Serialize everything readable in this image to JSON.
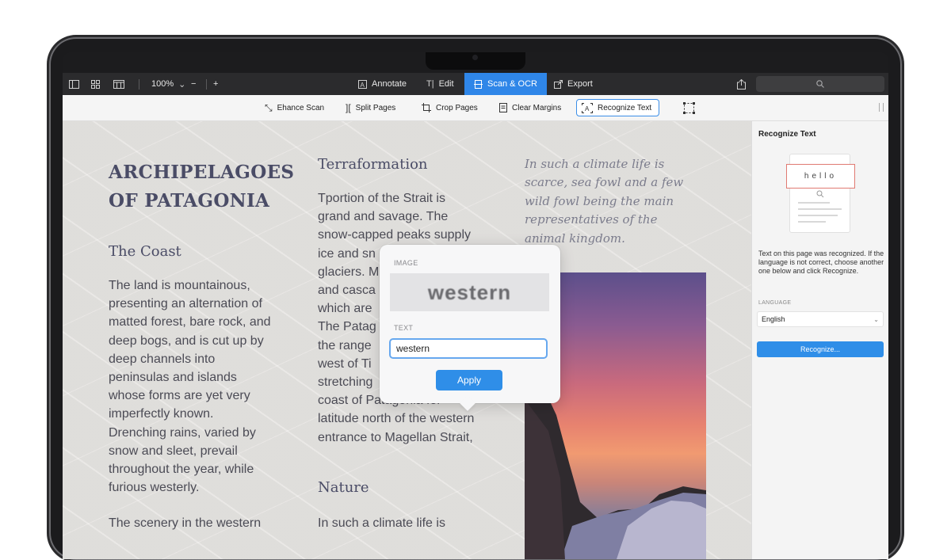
{
  "toolbar": {
    "zoom": "100%",
    "zoom_out": "−",
    "zoom_in": "+",
    "modes": [
      {
        "label": "Annotate",
        "icon": "A"
      },
      {
        "label": "Edit",
        "icon": "T|"
      },
      {
        "label": "Scan & OCR",
        "icon": "▭"
      },
      {
        "label": "Export",
        "icon": "↗"
      }
    ],
    "active_mode": "Scan & OCR"
  },
  "subbar": {
    "items": [
      {
        "label": "Ehance Scan"
      },
      {
        "label": "Split Pages"
      },
      {
        "label": "Crop Pages"
      },
      {
        "label": "Clear Margins"
      },
      {
        "label": "Recognize Text"
      }
    ],
    "active_item": "Recognize Text"
  },
  "document": {
    "title": "ARCHIPELAGOES OF PATAGONIA",
    "coast_heading": "The Coast",
    "coast_text": "The land is mountainous,\npresenting an alternation of\nmatted forest, bare rock, and\ndeep bogs, and is cut up by\ndeep channels into\npeninsulas and islands\nwhose forms are yet very\nimperfectly known.\nDrenching rains, varied by\nsnow and sleet, prevail\nthroughout the year, while\nfurious westerly.",
    "coast_text_2": "The scenery in the western",
    "terraformation_heading": "Terraformation",
    "terraformation_text": "Tportion of the Strait is\ngrand and savage. The\nsnow-capped peaks supply\nice and sn\nglaciers. M\nand casca\nwhich are\nThe Patag\nthe range\nwest of Ti\nstretching\ncoast of Patagonia for\nlatitude north of the western\nentrance to Magellan Strait,",
    "nature_heading": "Nature",
    "nature_text": "In such a climate life is",
    "quote": "In such a climate life is\nscarce, sea fowl and a few\nwild fowl being the main\nrepresentatives of the\nanimal kingdom."
  },
  "popover": {
    "image_label": "IMAGE",
    "image_word": "western",
    "text_label": "TEXT",
    "text_value": "western",
    "apply_label": "Apply"
  },
  "panel": {
    "title": "Recognize Text",
    "sample_word": "hello",
    "note": "Text on this page was recognized. If the language is not correct, choose another one below and click Recognize.",
    "language_label": "LANGUAGE",
    "language_value": "English",
    "recognize_label": "Recognize..."
  },
  "colors": {
    "accent": "#2f8ee8",
    "toolbar_bg": "#2b2b2d",
    "heading": "#4a4c66"
  }
}
